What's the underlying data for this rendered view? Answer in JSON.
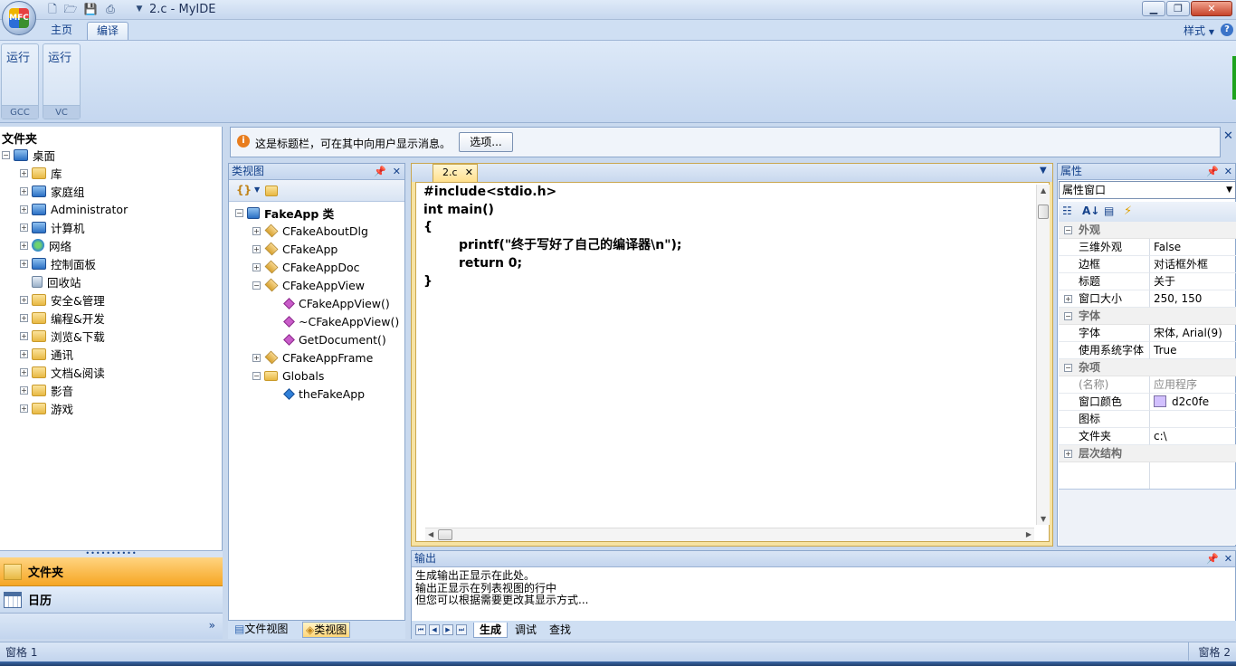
{
  "window": {
    "title": "2.c - MyIDE"
  },
  "ribbon": {
    "tabs": [
      "主页",
      "编译"
    ],
    "style_menu": "样式",
    "groups": [
      {
        "button": "运行",
        "label": "GCC"
      },
      {
        "button": "运行",
        "label": "VC"
      }
    ]
  },
  "folder_pane": {
    "title": "文件夹",
    "root": "桌面",
    "items": [
      "库",
      "家庭组",
      "Administrator",
      "计算机",
      "网络",
      "控制面板",
      "回收站",
      "安全&管理",
      "编程&开发",
      "浏览&下载",
      "通讯",
      "文档&阅读",
      "影音",
      "游戏"
    ],
    "nav_folders": "文件夹",
    "nav_calendar": "日历"
  },
  "infobar": {
    "message": "这是标题栏，可在其中向用户显示消息。",
    "options_button": "选项..."
  },
  "class_view": {
    "title": "类视图",
    "root": "FakeApp 类",
    "classes": [
      "CFakeAboutDlg",
      "CFakeApp",
      "CFakeAppDoc",
      "CFakeAppView"
    ],
    "methods": [
      "CFakeAppView()",
      "~CFakeAppView()",
      "GetDocument()"
    ],
    "frame_class": "CFakeAppFrame",
    "globals": "Globals",
    "global_item": "theFakeApp",
    "bottom_tabs": [
      "文件视图",
      "类视图"
    ]
  },
  "editor": {
    "tab": "2.c",
    "code": "#include<stdio.h>\nint main()\n{\n        printf(\"终于写好了自己的编译器\\n\");\n        return 0;\n}"
  },
  "properties": {
    "title": "属性",
    "combo": "属性窗口",
    "categories": {
      "appearance": "外观",
      "font": "字体",
      "misc": "杂项",
      "hierarchy": "层次结构"
    },
    "rows": [
      {
        "key": "三维外观",
        "value": "False"
      },
      {
        "key": "边框",
        "value": "对话框外框"
      },
      {
        "key": "标题",
        "value": "关于"
      },
      {
        "key": "窗口大小",
        "value": "250, 150"
      },
      {
        "key": "字体",
        "value": "宋体, Arial(9)"
      },
      {
        "key": "使用系统字体",
        "value": "True"
      },
      {
        "key": "(名称)",
        "value": "应用程序"
      },
      {
        "key": "窗口颜色",
        "value": "d2c0fe"
      },
      {
        "key": "图标",
        "value": ""
      },
      {
        "key": "文件夹",
        "value": "c:\\"
      }
    ],
    "window_color": "#d2c0fe"
  },
  "output": {
    "title": "输出",
    "lines": [
      "生成输出正显示在此处。",
      "输出正显示在列表视图的行中",
      "但您可以根据需要更改其显示方式..."
    ],
    "tabs": [
      "生成",
      "调试",
      "查找"
    ]
  },
  "status": {
    "left": "窗格 1",
    "right": "窗格 2"
  }
}
